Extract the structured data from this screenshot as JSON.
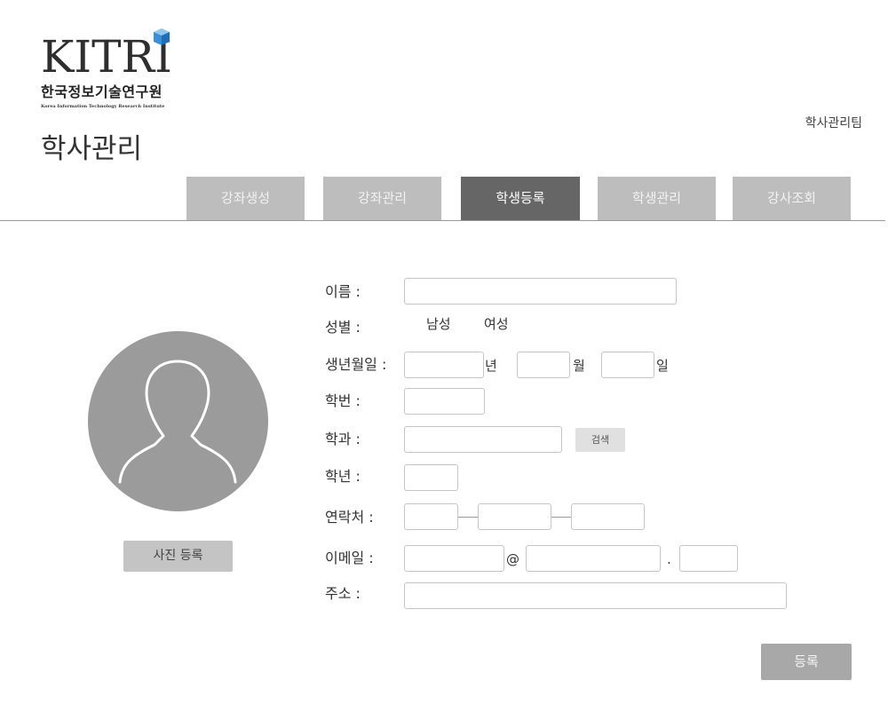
{
  "logo": {
    "wordmark": "KITRI",
    "korean": "한국정보기술연구원",
    "english": "Korea Information Technology Research Institute"
  },
  "page_title": "학사관리",
  "team_label": "학사관리팀",
  "tabs": [
    {
      "label": "강좌생성",
      "active": false
    },
    {
      "label": "강좌관리",
      "active": false
    },
    {
      "label": "학생등록",
      "active": true
    },
    {
      "label": "학생관리",
      "active": false
    },
    {
      "label": "강사조회",
      "active": false
    }
  ],
  "photo_button": "사진 등록",
  "form": {
    "name_label": "이름 :",
    "gender_label": "성별 :",
    "gender_male": "남성",
    "gender_female": "여성",
    "birth_label": "생년월일 :",
    "year_suffix": "년",
    "month_suffix": "월",
    "day_suffix": "일",
    "student_id_label": "학번 :",
    "department_label": "학과 :",
    "search_button": "검색",
    "grade_label": "학년 :",
    "contact_label": "연락처 :",
    "email_label": "이메일 :",
    "email_at": "@",
    "email_dot": ".",
    "address_label": "주소 :"
  },
  "submit_button": "등록",
  "colors": {
    "tab_inactive": "#bdbdbd",
    "tab_active": "#666666",
    "avatar_bg": "#9b9b9b",
    "submit_bg": "#a8a8a8"
  }
}
